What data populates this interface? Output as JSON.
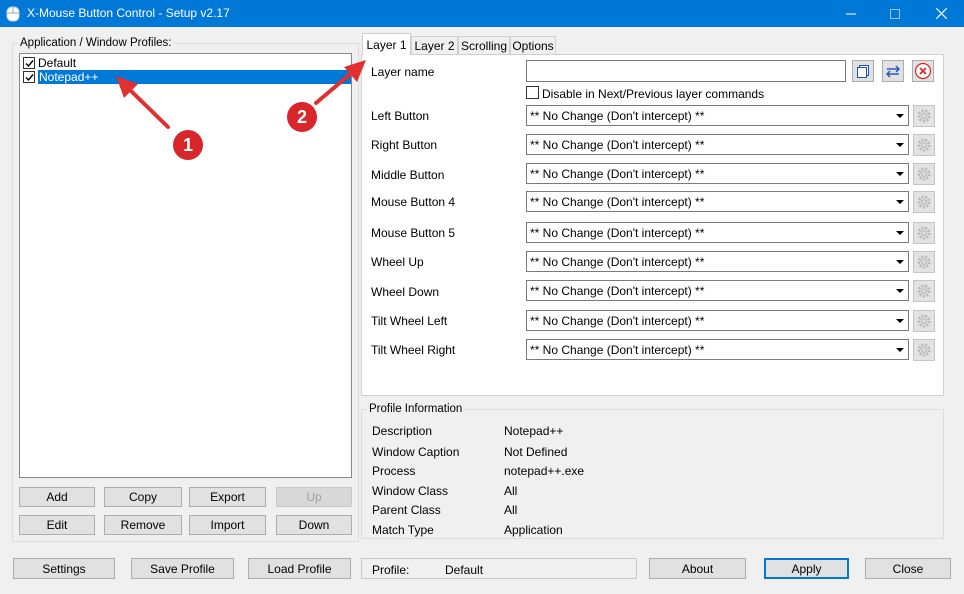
{
  "window": {
    "title": "X-Mouse Button Control - Setup v2.17",
    "icon": "mouse-icon",
    "accent_color": "#0078d7"
  },
  "profiles": {
    "label": "Application / Window Profiles:",
    "items": [
      {
        "label": "Default",
        "checked": true,
        "selected": false
      },
      {
        "label": "Notepad++",
        "checked": true,
        "selected": true
      }
    ],
    "buttons": {
      "add": "Add",
      "copy": "Copy",
      "export": "Export",
      "up": "Up",
      "edit": "Edit",
      "remove": "Remove",
      "import": "Import",
      "down": "Down"
    }
  },
  "tabs": [
    "Layer 1",
    "Layer 2",
    "Scrolling",
    "Options"
  ],
  "layer": {
    "name_label": "Layer name",
    "name_value": "",
    "disable_label": "Disable in Next/Previous layer commands",
    "disable_checked": false,
    "rows": [
      {
        "label": "Left Button",
        "value": "** No Change (Don't intercept) **"
      },
      {
        "label": "Right Button",
        "value": "** No Change (Don't intercept) **"
      },
      {
        "label": "Middle Button",
        "value": "** No Change (Don't intercept) **"
      },
      {
        "label": "Mouse Button 4",
        "value": "** No Change (Don't intercept) **"
      },
      {
        "label": "Mouse Button 5",
        "value": "** No Change (Don't intercept) **"
      },
      {
        "label": "Wheel Up",
        "value": "** No Change (Don't intercept) **"
      },
      {
        "label": "Wheel Down",
        "value": "** No Change (Don't intercept) **"
      },
      {
        "label": "Tilt Wheel Left",
        "value": "** No Change (Don't intercept) **"
      },
      {
        "label": "Tilt Wheel Right",
        "value": "** No Change (Don't intercept) **"
      }
    ]
  },
  "profile_info": {
    "title": "Profile Information",
    "rows": [
      {
        "label": "Description",
        "value": "Notepad++"
      },
      {
        "label": "Window Caption",
        "value": "Not Defined"
      },
      {
        "label": "Process",
        "value": "notepad++.exe"
      },
      {
        "label": "Window Class",
        "value": "All"
      },
      {
        "label": "Parent Class",
        "value": "All"
      },
      {
        "label": "Match Type",
        "value": "Application"
      }
    ]
  },
  "footer": {
    "settings": "Settings",
    "save_profile": "Save Profile",
    "load_profile": "Load Profile",
    "profile_label": "Profile:",
    "profile_value": "Default",
    "about": "About",
    "apply": "Apply",
    "close": "Close"
  },
  "annotations": {
    "callout_1": "1",
    "callout_2": "2",
    "color": "#d9262a"
  }
}
